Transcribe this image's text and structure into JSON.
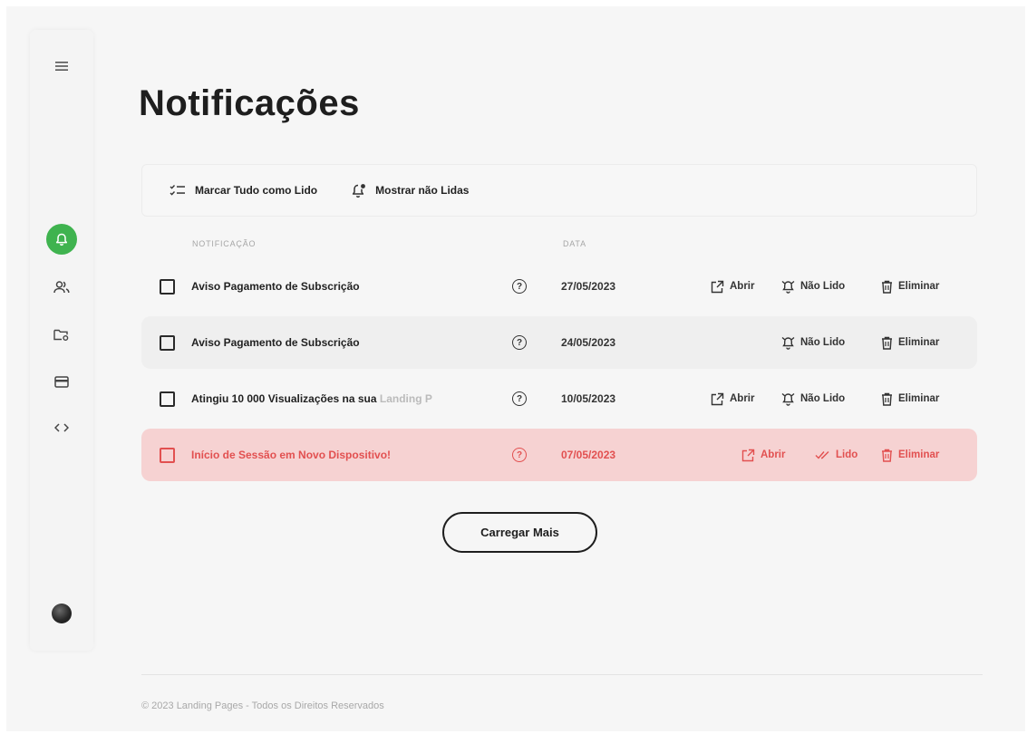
{
  "page": {
    "title": "Notificações"
  },
  "colors": {
    "accent": "#3fb34f",
    "alert": "#e25050",
    "alert_bg": "#f6d2d2"
  },
  "sidebar": {
    "items": [
      {
        "name": "menu-icon"
      },
      {
        "name": "bell-icon",
        "active": true
      },
      {
        "name": "users-icon"
      },
      {
        "name": "folder-settings-icon"
      },
      {
        "name": "credit-card-icon"
      },
      {
        "name": "code-icon"
      },
      {
        "name": "avatar"
      }
    ]
  },
  "toolbar": {
    "mark_all_read": "Marcar Tudo como Lido",
    "show_unread": "Mostrar não Lidas"
  },
  "table": {
    "headers": {
      "notification": "NOTIFICAÇÃO",
      "date": "DATA"
    },
    "rows": [
      {
        "name": "Aviso Pagamento de Subscrição",
        "name_fade": "",
        "date": "27/05/2023",
        "open": "Abrir",
        "toggle": "Não Lido",
        "delete": "Eliminar"
      },
      {
        "name": "Aviso Pagamento de Subscrição",
        "name_fade": "",
        "date": "24/05/2023",
        "open": "",
        "toggle": "Não Lido",
        "delete": "Eliminar"
      },
      {
        "name": "Atingiu 10 000 Visualizações na sua ",
        "name_fade": "Landing P",
        "date": "10/05/2023",
        "open": "Abrir",
        "toggle": "Não Lido",
        "delete": "Eliminar"
      },
      {
        "name": "Início de Sessão em Novo Dispositivo!",
        "name_fade": "",
        "date": "07/05/2023",
        "open": "Abrir",
        "toggle": "Lido",
        "delete": "Eliminar"
      }
    ]
  },
  "load_more": "Carregar Mais",
  "footer": "© 2023 Landing Pages - Todos os Direitos Reservados"
}
